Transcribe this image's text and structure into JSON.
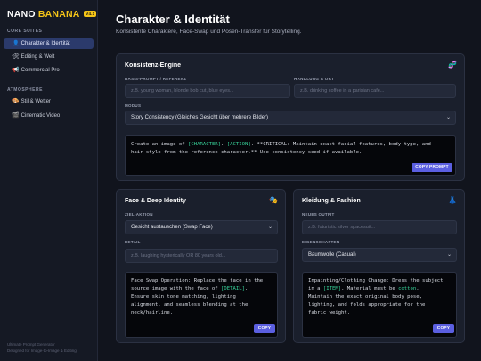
{
  "app": {
    "logo_word1": "NANO",
    "logo_word2": "BANANA",
    "logo_badge": "V4.1"
  },
  "sidebar": {
    "section1": "CORE SUITES",
    "section2": "ATMOSPHERE",
    "items": [
      {
        "icon": "👤",
        "label": "Charakter & Identität",
        "active": true
      },
      {
        "icon": "🛠",
        "label": "Editing & Welt"
      },
      {
        "icon": "📢",
        "label": "Commercial Pro"
      },
      {
        "icon": "🎨",
        "label": "Stil & Wetter"
      },
      {
        "icon": "🎬",
        "label": "Cinematic Video"
      }
    ],
    "footer_line1": "Ultimate Prompt Generator",
    "footer_line2": "Designed for Image-to-Image & Editing"
  },
  "page": {
    "title": "Charakter & Identität",
    "subtitle": "Konsistente Charaktere, Face-Swap und Posen-Transfer für Storytelling."
  },
  "consistency": {
    "title": "Konsistenz-Engine",
    "icon": "🧬",
    "basis_label": "BASIS-PROMPT / REFERENZ",
    "basis_placeholder": "z.B. young woman, blonde bob cut, blue eyes...",
    "action_label": "HANDLUNG & ORT",
    "action_placeholder": "z.B. drinking coffee in a parisian cafe...",
    "mode_label": "MODUS",
    "mode_value": "Story Consistency (Gleiches Gesicht über mehrere Bilder)",
    "prompt_a": "Create an image of ",
    "prompt_tag1": "[CHARACTER]",
    "prompt_b": ". ",
    "prompt_tag2": "[ACTION]",
    "prompt_c": ". **CRITICAL: Maintain exact facial features, body type, and",
    "prompt_d": "hair style from the reference character.** Use consistency seed if available.",
    "copy_button": "COPY PROMPT"
  },
  "face": {
    "title": "Face & Deep Identity",
    "icon": "🎭",
    "target_label": "ZIEL-AKTION",
    "target_value": "Gesicht austauschen (Swap Face)",
    "detail_label": "DETAIL",
    "detail_placeholder": "z.B. laughing hysterically OR 80 years old...",
    "l1": "Face Swap Operation: Replace the face in the",
    "l2a": "source image with the face of ",
    "l2tag": "[DETAIL]",
    "l2b": ".",
    "l3": "Ensure skin tone matching, lighting",
    "l4": "alignment, and seamless blending at the",
    "l5": "neck/hairline.",
    "copy_button": "COPY"
  },
  "clothing": {
    "title": "Kleidung & Fashion",
    "icon": "👗",
    "outfit_label": "NEUES OUTFIT",
    "outfit_placeholder": "z.B. futuristic silver spacesuit...",
    "props_label": "EIGENSCHAFTEN",
    "props_value": "Baumwolle (Casual)",
    "l1": "Inpainting/Clothing Change: Dress the subject",
    "l2a": "in a ",
    "l2tag": "[ITEM]",
    "l2b": ". Material must be ",
    "l2tag2": "cotton",
    "l2c": ".",
    "l3": "Maintain the exact original body pose,",
    "l4": "lighting, and folds appropriate for the",
    "l5": "fabric weight.",
    "copy_button": "COPY"
  },
  "colors": {
    "accent": "#5b5fe0",
    "brand_yellow": "#f5c518",
    "code_highlight": "#37d39a",
    "active_nav": "#2b3a6b"
  }
}
